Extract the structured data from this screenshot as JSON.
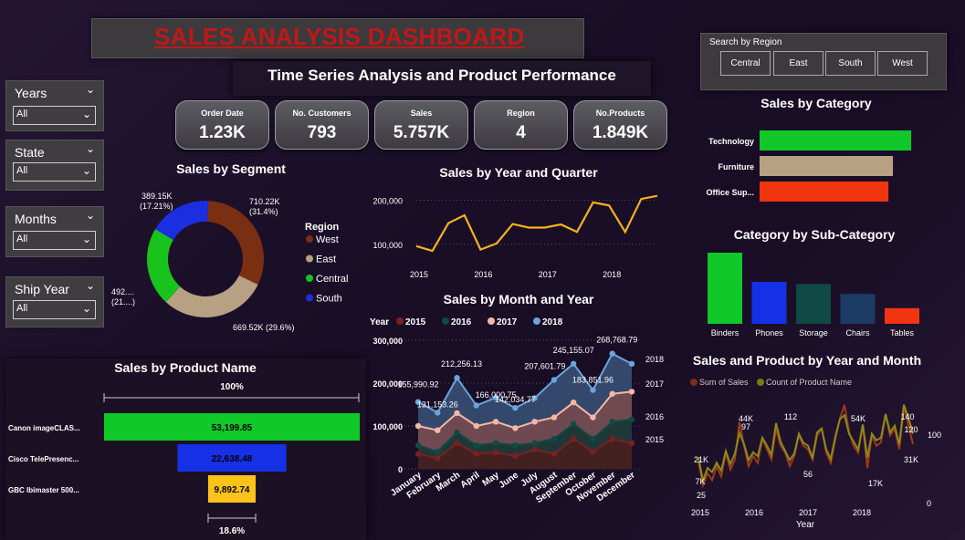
{
  "header": {
    "title": "SALES ANALYSIS DASHBOARD",
    "subtitle": "Time Series Analysis and Product Performance"
  },
  "slicers": [
    {
      "label": "Years",
      "value": "All"
    },
    {
      "label": "State",
      "value": "All"
    },
    {
      "label": "Months",
      "value": "All"
    },
    {
      "label": "Ship Year",
      "value": "All"
    }
  ],
  "kpis": [
    {
      "label": "Order Date",
      "value": "1.23K"
    },
    {
      "label": "No. Customers",
      "value": "793"
    },
    {
      "label": "Sales",
      "value": "5.757K"
    },
    {
      "label": "Region",
      "value": "4"
    },
    {
      "label": "No.Products",
      "value": "1.849K"
    }
  ],
  "region_search": {
    "label": "Search by Region",
    "options": [
      "Central",
      "East",
      "South",
      "West"
    ]
  },
  "colors": {
    "west": "#7a2e12",
    "east": "#b8a082",
    "central": "#19c31d",
    "south": "#1b2ee0",
    "line_gold": "#f5b21b",
    "green": "#10c82a",
    "blue": "#1630e6",
    "yellow": "#ffc21a"
  },
  "chart_data": [
    {
      "id": "segment",
      "type": "pie",
      "title": "Sales by Segment",
      "legend_title": "Region",
      "legend": [
        "West",
        "East",
        "Central",
        "South"
      ],
      "values": [
        710.22,
        669.52,
        492,
        389.15
      ],
      "units": "K",
      "labels": [
        "710.22K\n(31.4%)",
        "669.52K (29.6%)",
        "492....\n(21....)",
        "389.15K\n(17.21%)"
      ],
      "colors": [
        "#7a2e12",
        "#b8a082",
        "#19c31d",
        "#1b2ee0"
      ]
    },
    {
      "id": "year_quarter",
      "type": "line",
      "title": "Sales by Year and Quarter",
      "x_ticks": [
        "2015",
        "2016",
        "2017",
        "2018"
      ],
      "y_ticks": [
        "100,000",
        "200,000"
      ],
      "ylim": [
        50000,
        230000
      ],
      "values": [
        96000,
        85000,
        148000,
        166000,
        88000,
        102000,
        146000,
        138000,
        138000,
        145000,
        128000,
        195000,
        188000,
        128000,
        203000,
        210000
      ]
    },
    {
      "id": "month_year",
      "type": "area",
      "title": "Sales by Month and Year",
      "legend_title": "Year",
      "legend": [
        "2015",
        "2016",
        "2017",
        "2018"
      ],
      "categories": [
        "January",
        "February",
        "March",
        "April",
        "May",
        "June",
        "July",
        "August",
        "September",
        "October",
        "November",
        "December"
      ],
      "y_ticks": [
        "0",
        "100,000",
        "200,000",
        "300,000"
      ],
      "ylim": [
        0,
        300000
      ],
      "series": [
        {
          "name": "2015",
          "values": [
            35000,
            25000,
            60000,
            35000,
            38000,
            30000,
            45000,
            35000,
            70000,
            40000,
            70000,
            60000
          ]
        },
        {
          "name": "2016",
          "values": [
            55000,
            40000,
            85000,
            55000,
            60000,
            55000,
            60000,
            70000,
            105000,
            70000,
            110000,
            115000
          ]
        },
        {
          "name": "2017",
          "values": [
            100000,
            90000,
            130000,
            100000,
            110000,
            95000,
            110000,
            120000,
            155000,
            120000,
            175000,
            180000
          ]
        },
        {
          "name": "2018",
          "values": [
            155990.92,
            131153.26,
            212256.13,
            148000,
            166000.75,
            142034.77,
            165000,
            207601.79,
            245155.07,
            183851.96,
            268768.79,
            245000
          ]
        }
      ],
      "data_labels": [
        "155,990.92",
        "131,153.26",
        "212,256.13",
        "166,000.75",
        "142,034.77",
        "207,601.79",
        "245,155.07",
        "183,851.96",
        "268,768.79"
      ],
      "end_labels": [
        "2018",
        "2017",
        "2016",
        "2015"
      ],
      "colors": [
        "#7a2020",
        "#0f4a44",
        "#f2b8a5",
        "#6aa4dd"
      ]
    },
    {
      "id": "product",
      "type": "bar",
      "title": "Sales by Product Name",
      "categories": [
        "Canon imageCLAS...",
        "Cisco TelePresenc...",
        "GBC Ibimaster 500..."
      ],
      "values": [
        53199.85,
        22638.48,
        9892.74
      ],
      "value_labels": [
        "53,199.85",
        "22,638.48",
        "9,892.74"
      ],
      "top_percent": "100%",
      "bottom_percent": "18.6%",
      "colors": [
        "#10c82a",
        "#1630e6",
        "#ffc21a"
      ]
    },
    {
      "id": "category",
      "type": "bar",
      "title": "Sales by Category",
      "categories": [
        "Technology",
        "Furniture",
        "Office Sup..."
      ],
      "values": [
        100,
        88,
        85
      ],
      "colors": [
        "#10c82a",
        "#b8a082",
        "#f03510"
      ]
    },
    {
      "id": "subcategory",
      "type": "bar",
      "title": "Category by Sub-Category",
      "categories": [
        "Binders",
        "Phones",
        "Storage",
        "Chairs",
        "Tables"
      ],
      "values": [
        100,
        59,
        56,
        42,
        22
      ],
      "colors": [
        "#10c82a",
        "#1630e6",
        "#0f4a44",
        "#1b3a64",
        "#f03510"
      ]
    },
    {
      "id": "sales_product",
      "type": "line",
      "title": "Sales and Product by Year and Month",
      "legend": [
        "Sum of Sales",
        "Count of Product Name"
      ],
      "x_ticks": [
        "2015",
        "2016",
        "2017",
        "2018"
      ],
      "xlabel": "Year",
      "right_ticks": [
        "0",
        "100"
      ],
      "annotations": [
        "21K",
        "7K",
        "25",
        "44K",
        "97",
        "112",
        "56",
        "54K",
        "17K",
        "140",
        "120",
        "31K"
      ],
      "sales": [
        21,
        7,
        14,
        10,
        18,
        12,
        26,
        16,
        22,
        44,
        30,
        18,
        24,
        20,
        34,
        28,
        22,
        40,
        30,
        26,
        18,
        24,
        36,
        30,
        28,
        22,
        36,
        40,
        26,
        20,
        34,
        46,
        54,
        38,
        30,
        26,
        42,
        17,
        36,
        30,
        32,
        48,
        36,
        40,
        28,
        52,
        42,
        31
      ],
      "products": [
        60,
        25,
        44,
        38,
        52,
        40,
        70,
        50,
        66,
        97,
        80,
        56,
        68,
        62,
        90,
        78,
        64,
        112,
        84,
        70,
        56,
        66,
        96,
        82,
        78,
        60,
        98,
        104,
        72,
        58,
        92,
        118,
        124,
        96,
        84,
        72,
        110,
        60,
        96,
        86,
        90,
        126,
        98,
        108,
        80,
        140,
        120,
        96
      ],
      "colors": [
        "#7a2e12",
        "#7a7a12"
      ]
    }
  ]
}
